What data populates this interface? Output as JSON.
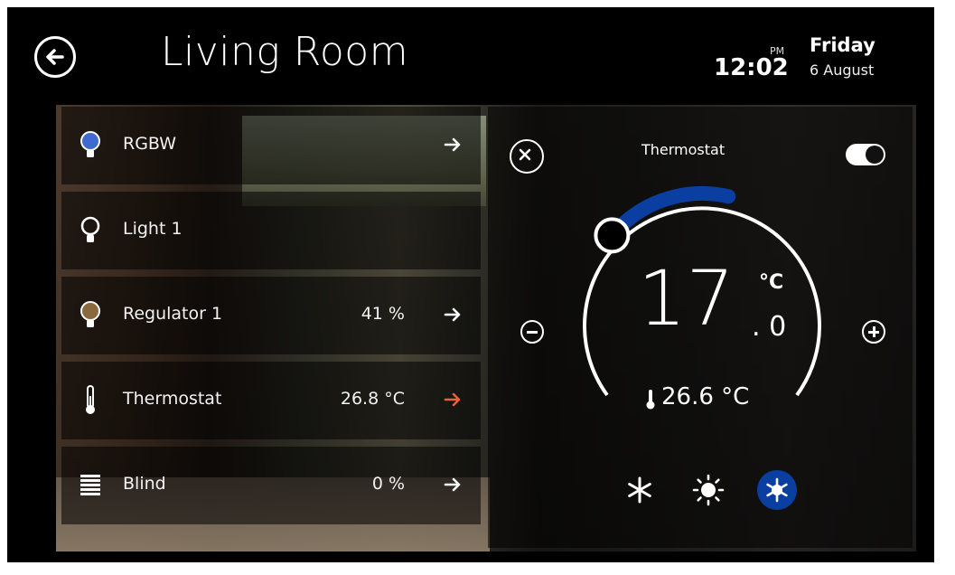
{
  "header": {
    "title": "Living Room",
    "ampm": "PM",
    "time": "12:02",
    "weekday": "Friday",
    "date": "6 August"
  },
  "devices": [
    {
      "label": "RGBW",
      "value": "",
      "icon": "bulb-blue-icon"
    },
    {
      "label": "Light 1",
      "value": "",
      "icon": "bulb-outline-icon"
    },
    {
      "label": "Regulator 1",
      "value": "41 %",
      "icon": "bulb-brown-icon"
    },
    {
      "label": "Thermostat",
      "value": "26.8 °C",
      "icon": "thermometer-icon"
    },
    {
      "label": "Blind",
      "value": "0 %",
      "icon": "blind-icon"
    }
  ],
  "thermostat": {
    "title": "Thermostat",
    "setpoint_int": "17",
    "setpoint_dec": ". 0",
    "unit": "°C",
    "current": "26.6 °C",
    "enabled": true,
    "modes": [
      "snowflake-icon",
      "sun-icon",
      "auto-mode-icon"
    ],
    "active_mode": "auto-mode-icon",
    "setpoint_arc_fraction": 0.18
  },
  "colors": {
    "accent_blue": "#0a3ea0",
    "arrow_active": "#e8603c",
    "rgbw_bulb": "#3f6bd0",
    "regulator_bulb": "#8a6a3c"
  }
}
